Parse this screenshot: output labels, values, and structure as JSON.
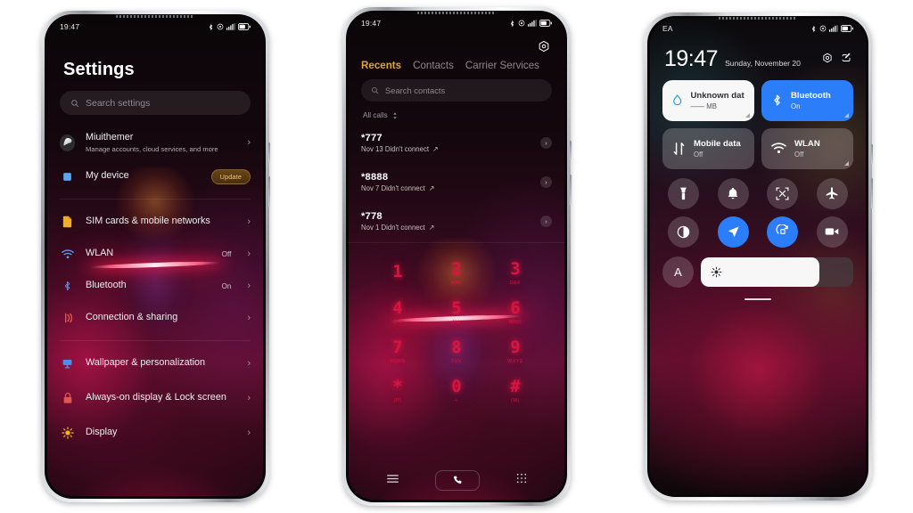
{
  "phone1": {
    "status": {
      "time": "19:47",
      "icons": [
        "bluetooth-icon",
        "alarm-icon",
        "signal-icon",
        "battery-icon"
      ]
    },
    "title": "Settings",
    "search": {
      "placeholder": "Search settings",
      "icon": "search-icon"
    },
    "account": {
      "name": "Miuithemer",
      "subtitle": "Manage accounts, cloud services, and more",
      "chevron": "›"
    },
    "device": {
      "label": "My device",
      "badge": "Update",
      "icon": "device-icon"
    },
    "group_a": [
      {
        "label": "SIM cards & mobile networks",
        "value": "",
        "icon": "sim-icon",
        "chevron": "›"
      },
      {
        "label": "WLAN",
        "value": "Off",
        "icon": "wifi-icon",
        "chevron": "›"
      },
      {
        "label": "Bluetooth",
        "value": "On",
        "icon": "bluetooth-icon",
        "chevron": "›"
      },
      {
        "label": "Connection & sharing",
        "value": "",
        "icon": "share-icon",
        "chevron": "›"
      }
    ],
    "group_b": [
      {
        "label": "Wallpaper & personalization",
        "value": "",
        "icon": "wallpaper-icon",
        "chevron": "›"
      },
      {
        "label": "Always-on display & Lock screen",
        "value": "",
        "icon": "lock-icon",
        "chevron": "›"
      },
      {
        "label": "Display",
        "value": "",
        "icon": "brightness-icon",
        "chevron": "›"
      }
    ]
  },
  "phone2": {
    "status": {
      "time": "19:47"
    },
    "gear_icon": "settings-gear-icon",
    "tabs": [
      {
        "label": "Recents",
        "active": true
      },
      {
        "label": "Contacts",
        "active": false
      },
      {
        "label": "Carrier Services",
        "active": false
      }
    ],
    "search": {
      "placeholder": "Search contacts",
      "icon": "search-icon"
    },
    "filter": {
      "label": "All calls",
      "icon": "sort-icon"
    },
    "calls": [
      {
        "number": "*777",
        "meta": "Nov 13 Didn't connect",
        "direction": "↗",
        "chevron": "›"
      },
      {
        "number": "*8888",
        "meta": "Nov 7 Didn't connect",
        "direction": "↗",
        "chevron": "›"
      },
      {
        "number": "*778",
        "meta": "Nov 1 Didn't connect",
        "direction": "↗",
        "chevron": "›"
      }
    ],
    "keypad": [
      {
        "digit": "1",
        "letters": ""
      },
      {
        "digit": "2",
        "letters": "ABC"
      },
      {
        "digit": "3",
        "letters": "DEF"
      },
      {
        "digit": "4",
        "letters": "GHI"
      },
      {
        "digit": "5",
        "letters": "JKL"
      },
      {
        "digit": "6",
        "letters": "MNO"
      },
      {
        "digit": "7",
        "letters": "PQRS"
      },
      {
        "digit": "8",
        "letters": "TUV"
      },
      {
        "digit": "9",
        "letters": "WXYZ"
      },
      {
        "digit": "*",
        "letters": "(P)"
      },
      {
        "digit": "0",
        "letters": "+"
      },
      {
        "digit": "#",
        "letters": "(W)"
      }
    ],
    "nav": {
      "menu_icon": "hamburger-menu-icon",
      "call_icon": "phone-call-icon",
      "keypad_icon": "dialpad-icon"
    }
  },
  "phone3": {
    "status": {
      "carrier": "EA"
    },
    "clock": {
      "time": "19:47",
      "date": "Sunday, November 20"
    },
    "header_actions": [
      {
        "icon": "settings-gear-icon"
      },
      {
        "icon": "edit-icon"
      }
    ],
    "tiles": [
      {
        "name": "Unknown data pl...",
        "state": "—— MB",
        "style": "white",
        "icon": "data-drop-icon"
      },
      {
        "name": "Bluetooth",
        "state": "On",
        "style": "blue",
        "icon": "bluetooth-icon"
      },
      {
        "name": "Mobile data",
        "state": "Off",
        "style": "grey",
        "icon": "mobile-data-icon"
      },
      {
        "name": "WLAN",
        "state": "Off",
        "style": "grey",
        "icon": "wifi-icon"
      }
    ],
    "toggles": [
      {
        "icon": "flashlight-icon",
        "on": false
      },
      {
        "icon": "ring-bell-icon",
        "on": false
      },
      {
        "icon": "screenshot-icon",
        "on": false
      },
      {
        "icon": "airplane-icon",
        "on": false
      },
      {
        "icon": "dark-mode-icon",
        "on": false
      },
      {
        "icon": "location-icon",
        "on": true
      },
      {
        "icon": "auto-rotate-icon",
        "on": true
      },
      {
        "icon": "screen-recorder-icon",
        "on": false
      }
    ],
    "brightness": {
      "auto_label": "A",
      "icon": "sun-icon",
      "percent": 78
    }
  },
  "colors": {
    "accent_red": "#d8143f",
    "accent_blue": "#2b7dfa",
    "accent_amber": "#e0a52e",
    "page_bg": "#ffffff"
  }
}
